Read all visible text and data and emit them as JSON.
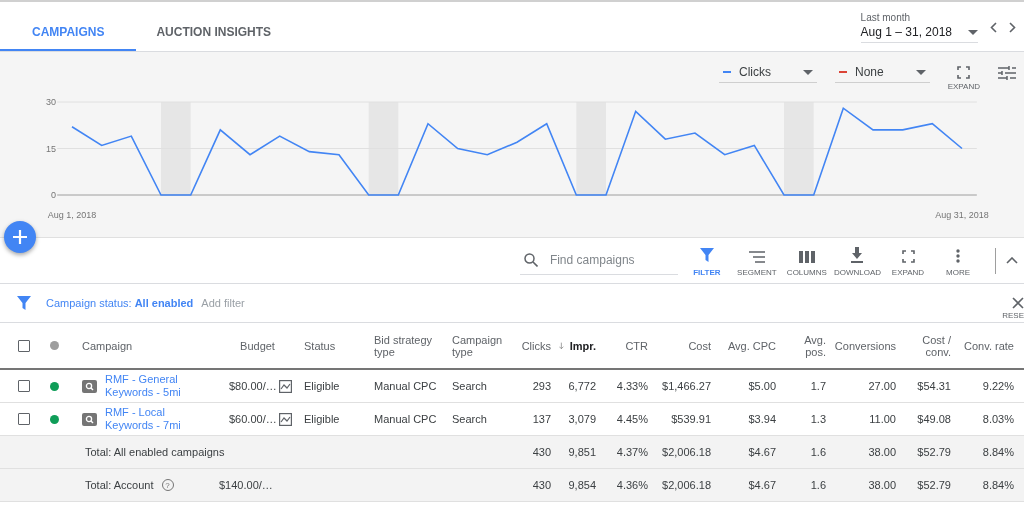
{
  "tabs": [
    {
      "label": "CAMPAIGNS",
      "selected": true
    },
    {
      "label": "AUCTION INSIGHTS",
      "selected": false
    }
  ],
  "date_range": {
    "caption": "Last month",
    "value": "Aug 1 – 31, 2018"
  },
  "chart_controls": {
    "metrics": [
      {
        "label": "Clicks",
        "color": "#4285f4"
      },
      {
        "label": "None",
        "color": "#db4437"
      }
    ],
    "expand_label": "EXPAND"
  },
  "chart_data": {
    "type": "line",
    "categories": [
      "Aug 1, 2018",
      null,
      null,
      null,
      null,
      null,
      null,
      null,
      null,
      null,
      null,
      null,
      null,
      null,
      null,
      null,
      null,
      null,
      null,
      null,
      null,
      null,
      null,
      null,
      null,
      null,
      null,
      null,
      null,
      null,
      "Aug 31, 2018"
    ],
    "yticks": [
      0,
      15,
      30
    ],
    "ylim": [
      0,
      30
    ],
    "series": [
      {
        "color": "#4285f4",
        "values": [
          22,
          16,
          19,
          0,
          0,
          21,
          13,
          19,
          14,
          13,
          0,
          0,
          23,
          15,
          13,
          17,
          23,
          0,
          0,
          27,
          18,
          20,
          13,
          16,
          0,
          0,
          28,
          21,
          21,
          23,
          15
        ]
      }
    ]
  },
  "toolbar": {
    "search": {
      "placeholder": "Find campaigns"
    },
    "tools": [
      {
        "kind": "filter",
        "label": "FILTER",
        "selected": true
      },
      {
        "kind": "segment",
        "label": "SEGMENT",
        "selected": false
      },
      {
        "kind": "columns",
        "label": "COLUMNS",
        "selected": false
      },
      {
        "kind": "download",
        "label": "DOWNLOAD",
        "selected": false
      },
      {
        "kind": "expand",
        "label": "EXPAND",
        "selected": false
      },
      {
        "kind": "more",
        "label": "MORE",
        "selected": false
      }
    ]
  },
  "filter_bar": {
    "filter": "Campaign status: **All enabled**",
    "add_filter": "Add filter",
    "reset_label": "RESE"
  },
  "table": {
    "header_checked": false,
    "columns": [
      {
        "label": "Campaign",
        "sorted": false
      },
      {
        "label": "Budget",
        "sorted": false
      },
      {
        "label": "Status",
        "sorted": false
      },
      {
        "label": "Bid strategy type",
        "sorted": false
      },
      {
        "label": "Campaign type",
        "sorted": false
      },
      {
        "label": "Clicks",
        "sorted": false
      },
      {
        "label": "Impr.",
        "sorted": true
      },
      {
        "label": "CTR",
        "sorted": false
      },
      {
        "label": "Cost",
        "sorted": false
      },
      {
        "label": "Avg. CPC",
        "sorted": false
      },
      {
        "label": "Avg. pos.",
        "sorted": false
      },
      {
        "label": "Conversions",
        "sorted": false
      },
      {
        "label": "Cost / conv.",
        "sorted": false
      },
      {
        "label": "Conv. rate",
        "sorted": false
      }
    ],
    "rows": [
      {
        "kind": "campaign",
        "checked": false,
        "color": "#0f9d58",
        "campaign": "RMF - General Keywords - 5mi",
        "budget": "$80.00/…",
        "status": "Eligible",
        "bid_strategy_type": "Manual CPC",
        "campaign_type": "Search",
        "metrics": [
          "293",
          "6,772",
          "4.33%",
          "$1,466.27",
          "$5.00",
          "1.7",
          "27.00",
          "$54.31",
          "9.22%"
        ]
      },
      {
        "kind": "campaign",
        "checked": false,
        "color": "#0f9d58",
        "campaign": "RMF - Local Keywords - 7mi",
        "budget": "$60.00/…",
        "status": "Eligible",
        "bid_strategy_type": "Manual CPC",
        "campaign_type": "Search",
        "metrics": [
          "137",
          "3,079",
          "4.45%",
          "$539.91",
          "$3.94",
          "1.3",
          "11.00",
          "$49.08",
          "8.03%"
        ]
      },
      {
        "kind": "total",
        "campaign": "Total: All enabled campaigns",
        "metrics": [
          "430",
          "9,851",
          "4.37%",
          "$2,006.18",
          "$4.67",
          "1.6",
          "38.00",
          "$52.79",
          "8.84%"
        ]
      },
      {
        "kind": "total",
        "campaign": "Total: Account",
        "help": "?",
        "budget": "$140.00/…",
        "metrics": [
          "430",
          "9,854",
          "4.36%",
          "$2,006.18",
          "$4.67",
          "1.6",
          "38.00",
          "$52.79",
          "8.84%"
        ]
      }
    ]
  }
}
